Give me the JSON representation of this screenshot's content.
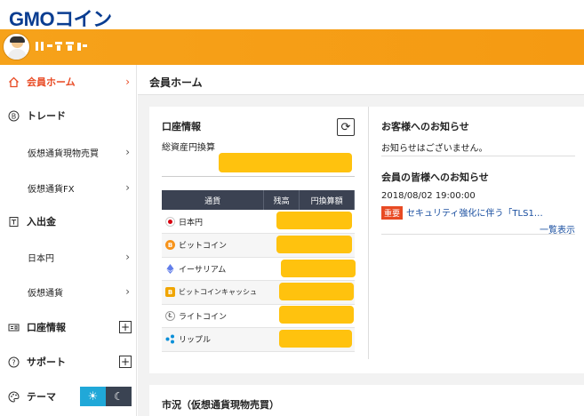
{
  "brand": {
    "logo_main": "GMO",
    "logo_sub": "コイン"
  },
  "sidebar": {
    "items": [
      {
        "label": "会員ホーム",
        "icon": "home-icon",
        "active": true
      },
      {
        "label": "トレード",
        "icon": "bitcoin-icon"
      },
      {
        "label": "仮想通貨現物売買",
        "sub": true
      },
      {
        "label": "仮想通貨FX",
        "sub": true
      },
      {
        "label": "入出金",
        "icon": "deposit-icon"
      },
      {
        "label": "日本円",
        "sub": true
      },
      {
        "label": "仮想通貨",
        "sub": true
      },
      {
        "label": "口座情報",
        "icon": "id-card-icon"
      },
      {
        "label": "サポート",
        "icon": "help-icon"
      },
      {
        "label": "テーマ",
        "icon": "palette-icon"
      }
    ]
  },
  "main": {
    "title": "会員ホーム",
    "account": {
      "title": "口座情報",
      "total_label": "総資産円換算",
      "table": {
        "headers": [
          "通貨",
          "残高",
          "円換算額"
        ],
        "rows": [
          {
            "currency": "日本円",
            "icon_color": "#d7000f"
          },
          {
            "currency": "ビットコイン",
            "icon_color": "#f7931a"
          },
          {
            "currency": "イーサリアム",
            "icon_color": "#627eea"
          },
          {
            "currency": "ビットコインキャッシュ",
            "icon_color": "#f0a500"
          },
          {
            "currency": "ライトコイン",
            "icon_color": "#9c9c9c"
          },
          {
            "currency": "リップル",
            "icon_color": "#0a8fd8"
          }
        ]
      }
    },
    "notices": {
      "customer_title": "お客様へのお知らせ",
      "customer_text": "お知らせはございません。",
      "member_title": "会員の皆様へのお知らせ",
      "news_date": "2018/08/02 19:00:00",
      "news_badge": "重要",
      "news_text": "セキュリティ強化に伴う「TLS1…",
      "more_link": "一覧表示"
    },
    "market_title": "市況（仮想通貨現物売買）"
  },
  "colors": {
    "accent": "#e84a23",
    "header_orange": "#f6a21a",
    "table_header": "#3b4252",
    "redaction": "#ffc20e"
  }
}
